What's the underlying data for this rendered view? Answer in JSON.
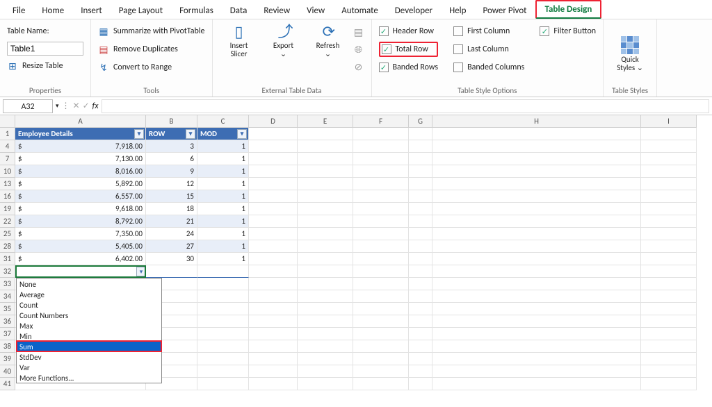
{
  "ribbon_tabs": [
    "File",
    "Home",
    "Insert",
    "Page Layout",
    "Formulas",
    "Data",
    "Review",
    "View",
    "Automate",
    "Developer",
    "Help",
    "Power Pivot",
    "Table Design"
  ],
  "active_tab": "Table Design",
  "properties": {
    "name_label": "Table Name:",
    "table_name": "Table1",
    "resize": "Resize Table",
    "group_label": "Properties"
  },
  "tools": {
    "pivot": "Summarize with PivotTable",
    "remove_dup": "Remove Duplicates",
    "convert": "Convert to Range",
    "group_label": "Tools"
  },
  "external": {
    "slicer": "Insert\nSlicer",
    "export": "Export",
    "refresh": "Refresh",
    "group_label": "External Table Data"
  },
  "style_opts": {
    "header_row": "Header Row",
    "total_row": "Total Row",
    "banded_rows": "Banded Rows",
    "first_col": "First Column",
    "last_col": "Last Column",
    "banded_cols": "Banded Columns",
    "filter_btn": "Filter Button",
    "group_label": "Table Style Options"
  },
  "styles": {
    "quick": "Quick\nStyles ⌄",
    "group_label": "Table Styles"
  },
  "namebox": "A32",
  "columns": [
    "A",
    "B",
    "C",
    "D",
    "E",
    "F",
    "G",
    "H",
    "I"
  ],
  "table_headers": [
    "Employee Details",
    "ROW",
    "MOD"
  ],
  "row_numbers": [
    1,
    4,
    7,
    10,
    13,
    16,
    19,
    22,
    25,
    28,
    31,
    32,
    33,
    34,
    35,
    36,
    37,
    38,
    39,
    40,
    41
  ],
  "data_rows": [
    {
      "r": 4,
      "emp": "7,918.00",
      "row": "3",
      "mod": "1"
    },
    {
      "r": 7,
      "emp": "7,130.00",
      "row": "6",
      "mod": "1"
    },
    {
      "r": 10,
      "emp": "8,016.00",
      "row": "9",
      "mod": "1"
    },
    {
      "r": 13,
      "emp": "5,892.00",
      "row": "12",
      "mod": "1"
    },
    {
      "r": 16,
      "emp": "6,557.00",
      "row": "15",
      "mod": "1"
    },
    {
      "r": 19,
      "emp": "9,618.00",
      "row": "18",
      "mod": "1"
    },
    {
      "r": 22,
      "emp": "8,792.00",
      "row": "21",
      "mod": "1"
    },
    {
      "r": 25,
      "emp": "7,350.00",
      "row": "24",
      "mod": "1"
    },
    {
      "r": 28,
      "emp": "5,405.00",
      "row": "27",
      "mod": "1"
    },
    {
      "r": 31,
      "emp": "6,402.00",
      "row": "30",
      "mod": "1"
    }
  ],
  "func_options": [
    "None",
    "Average",
    "Count",
    "Count Numbers",
    "Max",
    "Min",
    "Sum",
    "StdDev",
    "Var",
    "More Functions..."
  ],
  "func_selected": "Sum"
}
